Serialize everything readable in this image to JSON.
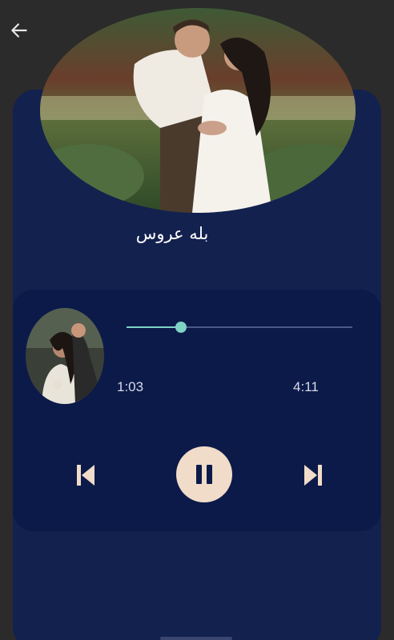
{
  "header": {
    "back_icon": "arrow-left-icon"
  },
  "song": {
    "title": "بله عروس",
    "cover_image": "couple-embracing-in-garden-photo",
    "thumb_image": "couple-portrait-photo"
  },
  "player": {
    "current_time": "1:03",
    "duration": "4:11",
    "progress": 0.24,
    "prev_icon": "skip-previous-icon",
    "play_icon": "pause-icon",
    "next_icon": "skip-next-icon"
  },
  "colors": {
    "background": "#2b2b2b",
    "card": "#13214f",
    "player_card": "#0c1a4a",
    "accent": "#7fd3c5",
    "play_button": "#f0dcc8"
  }
}
